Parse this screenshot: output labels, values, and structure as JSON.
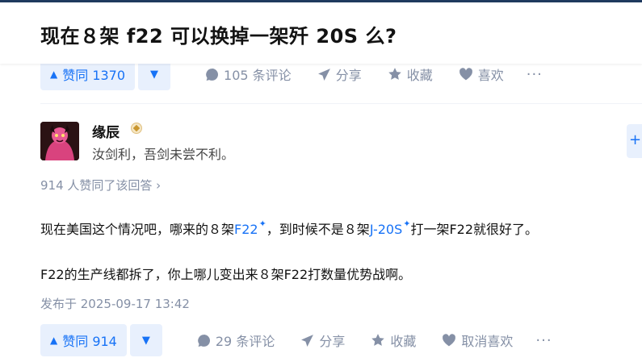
{
  "question": {
    "title": "现在８架 f22 可以换掉一架歼 20S 么?"
  },
  "top_actions": {
    "upvote_label": "赞同 1370",
    "comments_label": "105 条评论",
    "share_label": "分享",
    "favorite_label": "收藏",
    "like_label": "喜欢",
    "more_label": "···"
  },
  "author": {
    "name": "缘辰",
    "bio": "汝剑利，吾剑未尝不利。"
  },
  "answer": {
    "upvote_summary": "914 人赞同了该回答 ›",
    "para1_before": "现在美国这个情况吧，哪来的８架",
    "para1_link1": "F22",
    "para1_middle": "，到时候不是８架",
    "para1_link2": "J-20S",
    "para1_after": "打一架F22就很好了。",
    "para2": "F22的生产线都拆了，你上哪儿变出来８架F22打数量优势战啊。",
    "published": "发布于 2025-09-17 13:42"
  },
  "bottom_actions": {
    "upvote_label": "赞同 914",
    "comments_label": "29 条评论",
    "share_label": "分享",
    "favorite_label": "收藏",
    "like_label": "取消喜欢",
    "more_label": "···"
  },
  "colors": {
    "accent": "#1772f6",
    "accent_bg": "#e8f0fd",
    "meta": "#8590a6"
  }
}
